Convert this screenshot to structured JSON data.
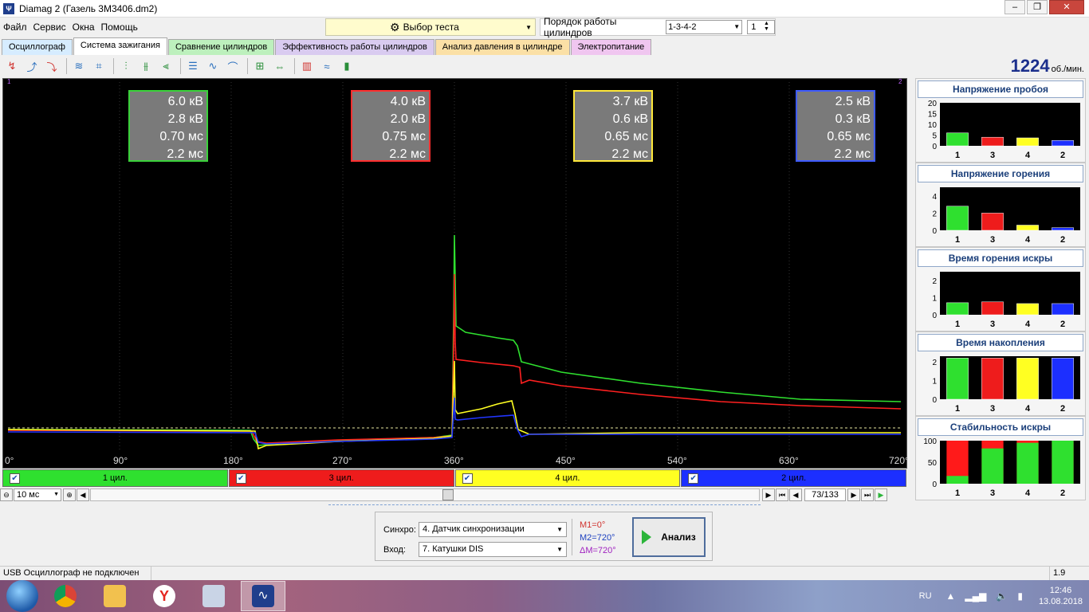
{
  "window": {
    "title": "Diamag 2 (Газель 3М3406.dm2)",
    "app_icon": "Ψ",
    "controls": [
      "–",
      "❐",
      "✕"
    ]
  },
  "menu": [
    "Файл",
    "Сервис",
    "Окна",
    "Помощь"
  ],
  "test_select": {
    "label": "Выбор теста"
  },
  "cylinder_order": {
    "label": "Порядок работы цилиндров",
    "value": "1-3-4-2",
    "spin": "1"
  },
  "tabs": [
    {
      "label": "Осциллограф",
      "color": "#d6ecff",
      "active": false
    },
    {
      "label": "Система зажигания",
      "color": "#ffffff",
      "active": true
    },
    {
      "label": "Сравнение цилиндров",
      "color": "#bdf0bd",
      "active": false
    },
    {
      "label": "Эффективность работы цилиндров",
      "color": "#d9cbf0",
      "active": false
    },
    {
      "label": "Анализ давления в цилиндре",
      "color": "#fbe0a6",
      "active": false
    },
    {
      "label": "Электропитание",
      "color": "#f0c6f0",
      "active": false
    }
  ],
  "rpm": {
    "value": "1224",
    "unit": "об./мин."
  },
  "measure_boxes": [
    {
      "color": "#3ad23a",
      "lines": [
        "6.0 кВ",
        "2.8 кВ",
        "0.70 мс",
        "2.2 мс"
      ]
    },
    {
      "color": "#ff2f2f",
      "lines": [
        "4.0 кВ",
        "2.0 кВ",
        "0.75 мс",
        "2.2 мс"
      ]
    },
    {
      "color": "#ffe83a",
      "lines": [
        "3.7 кВ",
        "0.6 кВ",
        "0.65 мс",
        "2.2 мс"
      ]
    },
    {
      "color": "#3f5cff",
      "lines": [
        "2.5 кВ",
        "0.3 кВ",
        "0.65 мс",
        "2.2 мс"
      ]
    }
  ],
  "scope_markers": {
    "m1": "1",
    "m2": "2"
  },
  "x_axis": [
    "0°",
    "90°",
    "180°",
    "270°",
    "360°",
    "450°",
    "540°",
    "630°",
    "720°"
  ],
  "cylinders": [
    {
      "label": "1 цил.",
      "color": "#2fe02f",
      "checked": true
    },
    {
      "label": "3 цил.",
      "color": "#ee1c1c",
      "checked": true
    },
    {
      "label": "4 цил.",
      "color": "#ffff22",
      "checked": true
    },
    {
      "label": "2 цил.",
      "color": "#1c2fff",
      "checked": true
    }
  ],
  "timebase": "10 мс",
  "page": "73/133",
  "side_charts": [
    {
      "title": "Напряжение пробоя",
      "yticks": [
        "20",
        "15",
        "10",
        "5",
        "0"
      ],
      "ymax": 20,
      "values": [
        6.0,
        4.0,
        3.7,
        2.5
      ],
      "cats": [
        "1",
        "3",
        "4",
        "2"
      ]
    },
    {
      "title": "Напряжение горения",
      "yticks": [
        "4",
        "2",
        "0"
      ],
      "ymax": 5,
      "values": [
        2.8,
        2.0,
        0.6,
        0.3
      ],
      "cats": [
        "1",
        "3",
        "4",
        "2"
      ]
    },
    {
      "title": "Время горения искры",
      "yticks": [
        "2",
        "1",
        "0"
      ],
      "ymax": 2.5,
      "values": [
        0.7,
        0.75,
        0.65,
        0.65
      ],
      "cats": [
        "1",
        "3",
        "4",
        "2"
      ]
    },
    {
      "title": "Время накопления",
      "yticks": [
        "2",
        "1",
        "0"
      ],
      "ymax": 2.3,
      "values": [
        2.2,
        2.2,
        2.2,
        2.2
      ],
      "cats": [
        "1",
        "3",
        "4",
        "2"
      ]
    },
    {
      "title": "Стабильность искры",
      "yticks": [
        "100",
        "50",
        "0"
      ],
      "ymax": 100,
      "values": [
        18,
        82,
        95,
        100
      ],
      "cats": [
        "1",
        "3",
        "4",
        "2"
      ],
      "stability": true
    }
  ],
  "chart_data": [
    {
      "type": "bar",
      "title": "Напряжение пробоя",
      "categories": [
        "1",
        "3",
        "4",
        "2"
      ],
      "values": [
        6.0,
        4.0,
        3.7,
        2.5
      ],
      "ylim": [
        0,
        20
      ]
    },
    {
      "type": "bar",
      "title": "Напряжение горения",
      "categories": [
        "1",
        "3",
        "4",
        "2"
      ],
      "values": [
        2.8,
        2.0,
        0.6,
        0.3
      ],
      "ylim": [
        0,
        5
      ]
    },
    {
      "type": "bar",
      "title": "Время горения искры",
      "categories": [
        "1",
        "3",
        "4",
        "2"
      ],
      "values": [
        0.7,
        0.75,
        0.65,
        0.65
      ],
      "ylim": [
        0,
        2.5
      ]
    },
    {
      "type": "bar",
      "title": "Время накопления",
      "categories": [
        "1",
        "3",
        "4",
        "2"
      ],
      "values": [
        2.2,
        2.2,
        2.2,
        2.2
      ],
      "ylim": [
        0,
        2.3
      ]
    },
    {
      "type": "bar",
      "title": "Стабильность искры",
      "categories": [
        "1",
        "3",
        "4",
        "2"
      ],
      "values": [
        18,
        82,
        95,
        100
      ],
      "ylim": [
        0,
        100
      ]
    }
  ],
  "analysis": {
    "sync_label": "Синхро:",
    "sync_value": "4.  Датчик синхронизации",
    "input_label": "Вход:",
    "input_value": "7.  Катушки DIS",
    "m1": "M1=0°",
    "m2": "M2=720°",
    "dm": "ΔM=720°",
    "button": "Анализ"
  },
  "status": {
    "left": "USB Осциллограф не подключен",
    "right": "1.9"
  },
  "taskbar": {
    "lang": "RU",
    "time": "12:46",
    "date": "13.08.2018"
  }
}
